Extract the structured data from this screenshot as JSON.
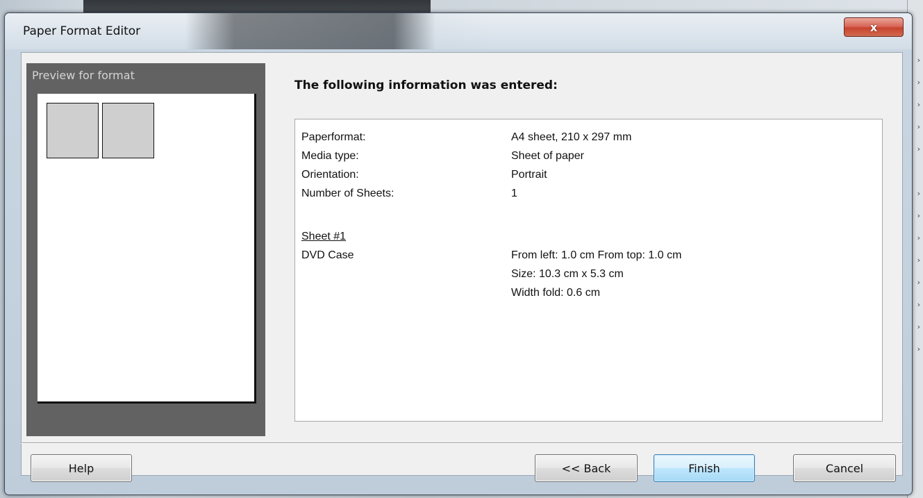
{
  "window": {
    "title": "Paper Format Editor",
    "close_label": "x"
  },
  "preview": {
    "label": "Preview for format"
  },
  "summary": {
    "heading": "The following information was entered:",
    "fields": [
      {
        "label": "Paperformat:",
        "value": "A4 sheet, 210 x 297 mm"
      },
      {
        "label": "Media type:",
        "value": "Sheet of paper"
      },
      {
        "label": "Orientation:",
        "value": "Portrait"
      },
      {
        "label": "Number of Sheets:",
        "value": "1"
      }
    ],
    "sheet": {
      "title": "Sheet #1",
      "item_label": "DVD Case",
      "details": [
        "From left: 1.0 cm From top: 1.0 cm",
        "Size: 10.3 cm x 5.3 cm",
        "Width fold: 0.6 cm"
      ]
    }
  },
  "buttons": {
    "help": "Help",
    "back": "<< Back",
    "finish": "Finish",
    "cancel": "Cancel"
  },
  "colors": {
    "preview_panel": "#626262",
    "finish_border": "#3c7fb1",
    "close_button": "#c8442f"
  }
}
